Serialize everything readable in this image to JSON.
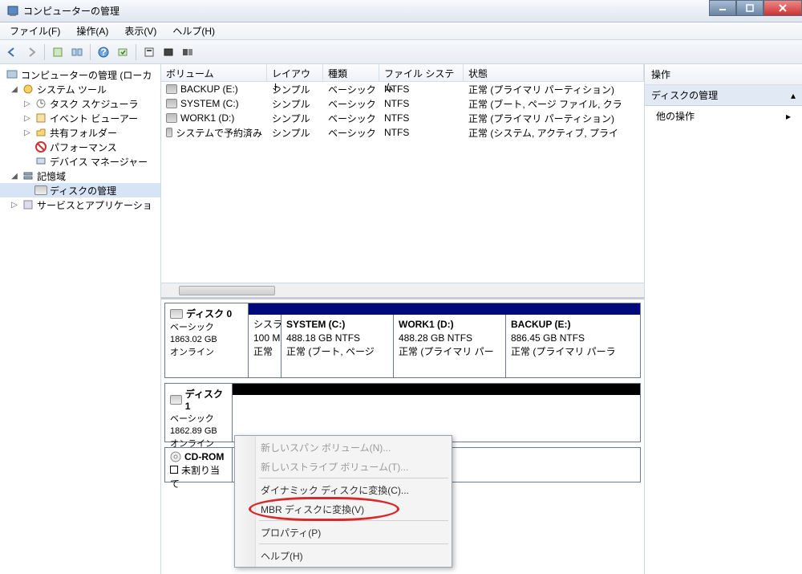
{
  "window": {
    "title": "コンピューターの管理"
  },
  "menus": {
    "file": "ファイル(F)",
    "action": "操作(A)",
    "view": "表示(V)",
    "help": "ヘルプ(H)"
  },
  "tree": {
    "root": "コンピューターの管理 (ローカ",
    "systools": "システム ツール",
    "task": "タスク スケジューラ",
    "event": "イベント ビューアー",
    "shared": "共有フォルダー",
    "perf": "パフォーマンス",
    "devmgr": "デバイス マネージャー",
    "storage": "記憶域",
    "diskmgmt": "ディスクの管理",
    "services": "サービスとアプリケーショ"
  },
  "vol": {
    "cols": {
      "volume": "ボリューム",
      "layout": "レイアウト",
      "type": "種類",
      "fs": "ファイル システム",
      "status": "状態"
    },
    "rows": [
      {
        "name": "BACKUP (E:)",
        "layout": "シンプル",
        "type": "ベーシック",
        "fs": "NTFS",
        "status": "正常 (プライマリ パーティション)"
      },
      {
        "name": "SYSTEM (C:)",
        "layout": "シンプル",
        "type": "ベーシック",
        "fs": "NTFS",
        "status": "正常 (ブート, ページ ファイル, クラ"
      },
      {
        "name": "WORK1 (D:)",
        "layout": "シンプル",
        "type": "ベーシック",
        "fs": "NTFS",
        "status": "正常 (プライマリ パーティション)"
      },
      {
        "name": "システムで予約済み",
        "layout": "シンプル",
        "type": "ベーシック",
        "fs": "NTFS",
        "status": "正常 (システム, アクティブ, プライ"
      }
    ]
  },
  "disk0": {
    "title": "ディスク 0",
    "type": "ベーシック",
    "size": "1863.02 GB",
    "status": "オンライン",
    "p0": {
      "name": "シスラ",
      "l2": "100 M",
      "l3": "正常"
    },
    "p1": {
      "name": "SYSTEM  (C:)",
      "l2": "488.18 GB NTFS",
      "l3": "正常 (ブート, ページ"
    },
    "p2": {
      "name": "WORK1  (D:)",
      "l2": "488.28 GB NTFS",
      "l3": "正常 (プライマリ パー"
    },
    "p3": {
      "name": "BACKUP  (E:)",
      "l2": "886.45 GB NTFS",
      "l3": "正常 (プライマリ パーラ"
    }
  },
  "disk1": {
    "title": "ディスク 1",
    "type": "ベーシック",
    "size": "1862.89 GB",
    "status": "オンライン"
  },
  "cdrom": {
    "title": "CD-ROM",
    "unalloc": "未割り当て"
  },
  "actions": {
    "header": "操作",
    "disk": "ディスクの管理",
    "other": "他の操作"
  },
  "ctx": {
    "span": "新しいスパン ボリューム(N)...",
    "stripe": "新しいストライプ ボリューム(T)...",
    "dynamic": "ダイナミック ディスクに変換(C)...",
    "mbr": "MBR ディスクに変換(V)",
    "prop": "プロパティ(P)",
    "help": "ヘルプ(H)"
  }
}
